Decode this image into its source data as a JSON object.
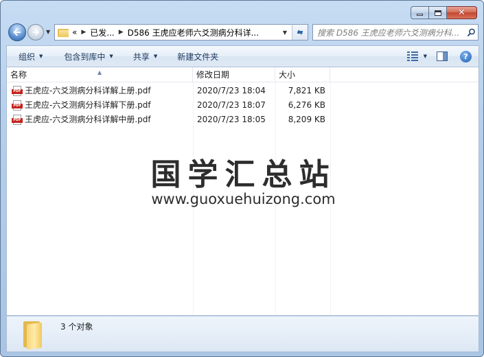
{
  "window": {
    "caption": {
      "minimize": "",
      "maximize": "",
      "close": "✕"
    }
  },
  "nav": {
    "breadcrumb_prefix": "«",
    "breadcrumb_parent": "已发...",
    "breadcrumb_separator": "▶",
    "breadcrumb_current": "D586 王虎应老师六爻测病分科详...",
    "search_placeholder": "搜索 D586 王虎应老师六爻测病分科..."
  },
  "toolbar": {
    "organize": "组织",
    "include_in_library": "包含到库中",
    "share": "共享",
    "new_folder": "新建文件夹"
  },
  "columns": {
    "name": "名称",
    "date": "修改日期",
    "size": "大小"
  },
  "files": [
    {
      "name": "王虎应-六爻测病分科详解上册.pdf",
      "date": "2020/7/23 18:04",
      "size": "7,821 KB",
      "icon": "pdf-icon"
    },
    {
      "name": "王虎应-六爻测病分科详解下册.pdf",
      "date": "2020/7/23 18:07",
      "size": "6,276 KB",
      "icon": "pdf-icon"
    },
    {
      "name": "王虎应-六爻测病分科详解中册.pdf",
      "date": "2020/7/23 18:05",
      "size": "8,209 KB",
      "icon": "pdf-icon"
    }
  ],
  "watermark": {
    "cn": "国学汇总站",
    "url": "www.guoxuehuizong.com"
  },
  "status": {
    "count": "3 个对象"
  },
  "colors": {
    "frame": "#b4cde9",
    "accent": "#1e395b",
    "pdf_red": "#c4231d"
  }
}
